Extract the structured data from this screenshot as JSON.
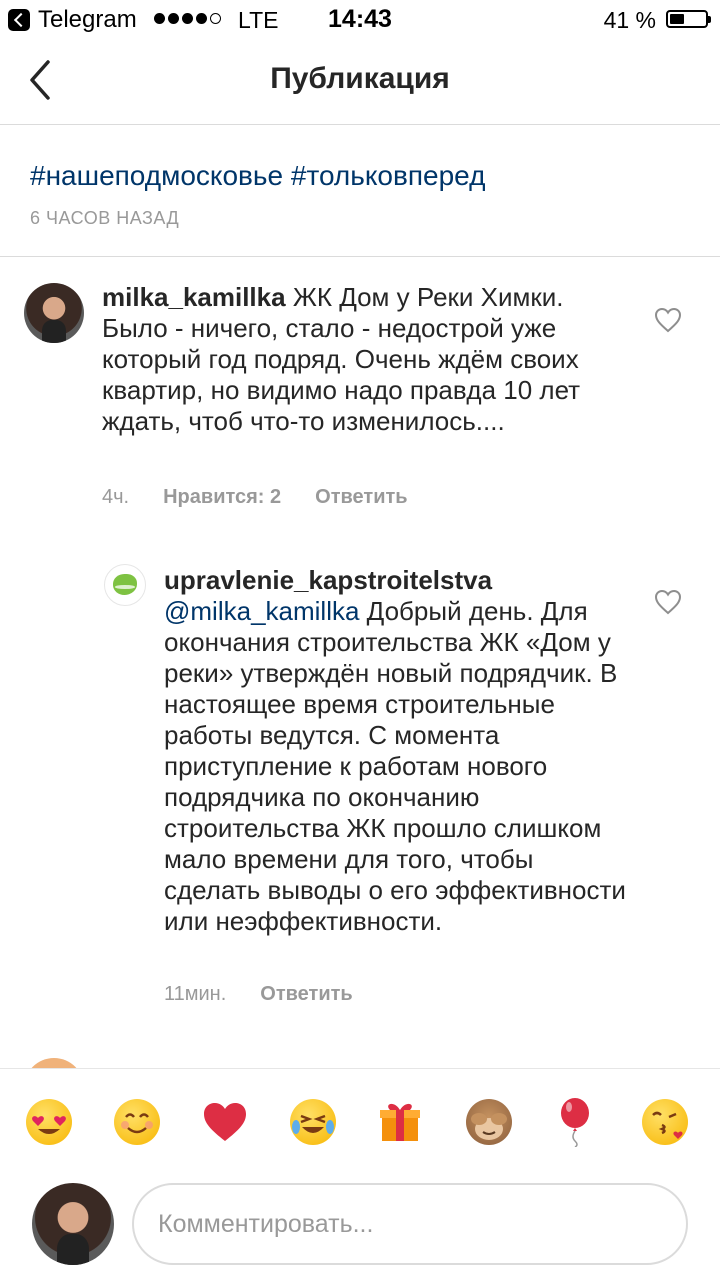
{
  "status_bar": {
    "app": "Telegram",
    "carrier": "LTE",
    "time": "14:43",
    "battery": "41 %",
    "battery_level": 0.41,
    "signal_bars": 4
  },
  "nav": {
    "title": "Публикация"
  },
  "post": {
    "caption": "#нашеподмосковье #тольковперед",
    "time": "6 ЧАСОВ НАЗАД"
  },
  "comments": [
    {
      "username": "milka_kamillka",
      "text": "ЖК Дом у Реки Химки. Было - ничего, стало - недострой уже который год подряд. Очень ждём своих квартир, но видимо надо правда 10 лет ждать, чтоб что-то изменилось....",
      "time": "4ч.",
      "likes": "Нравится: 2",
      "reply": "Ответить"
    },
    {
      "username": "upravlenie_kapstroitelstva",
      "mention": "@milka_kamillka",
      "text": "Добрый день. Для окончания строительства ЖК «Дом у реки» утверждён новый подрядчик. В настоящее время строительные работы ведутся. С момента приступление к работам нового подрядчика по окончанию строительства ЖК прошло слишком мало времени для того, чтобы сделать выводы о его эффективности или неэффективности.",
      "time": "11мин.",
      "reply": "Ответить"
    }
  ],
  "emoji_bar": [
    "heart-eyes",
    "smile",
    "red-heart",
    "joy",
    "gift",
    "see-no-evil-monkey",
    "balloon",
    "kissing-heart"
  ],
  "composer": {
    "placeholder": "Комментировать..."
  },
  "colors": {
    "link": "#003569",
    "muted": "#999999",
    "text": "#262626",
    "divider": "#dbdbdb"
  }
}
